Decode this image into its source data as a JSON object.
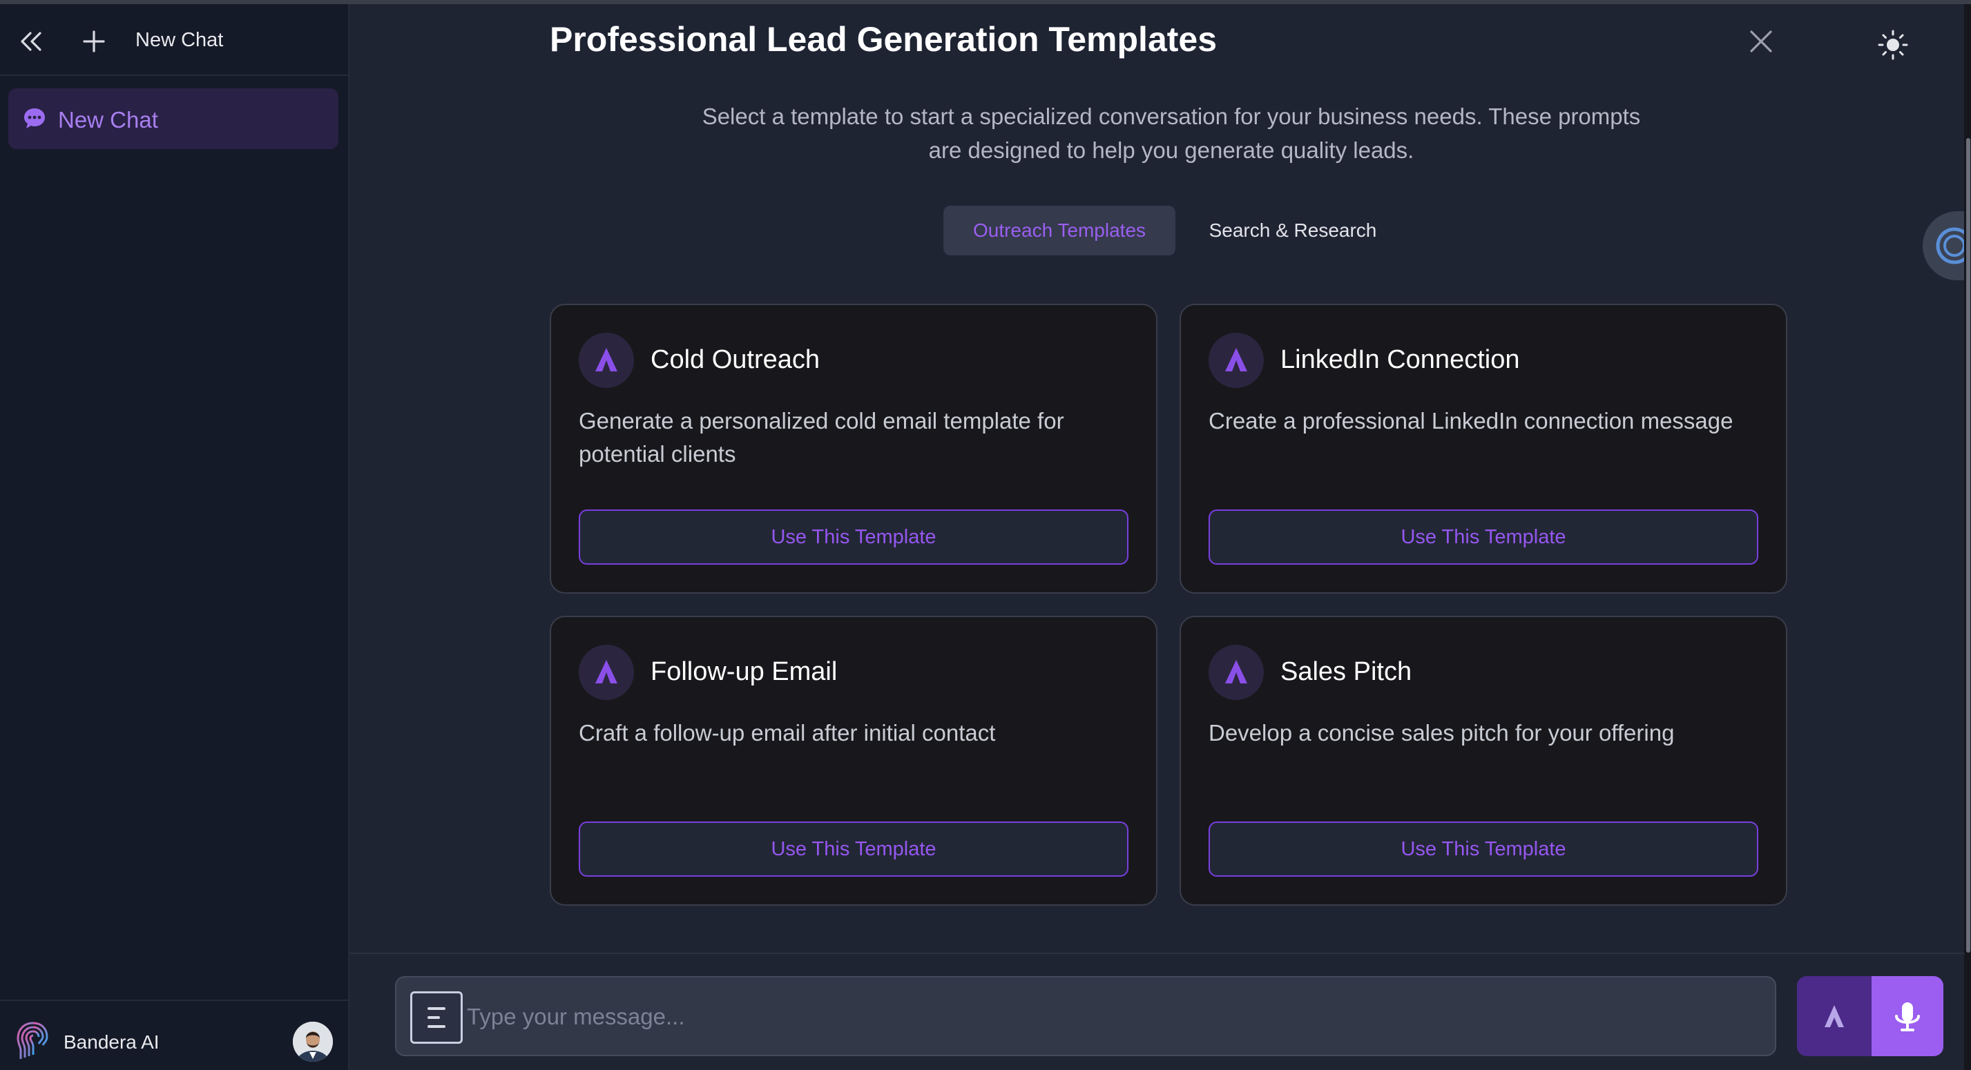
{
  "sidebar": {
    "header_title": "New Chat",
    "items": [
      {
        "label": "New Chat",
        "icon": "chat-bubble-icon",
        "active": true
      }
    ],
    "footer": {
      "brand_name": "Bandera AI",
      "brand_icon": "fingerprint-brain-icon",
      "avatar": "user-avatar"
    }
  },
  "main": {
    "title": "Professional Lead Generation Templates",
    "subtitle": "Select a template to start a specialized conversation for your business needs. These prompts are designed to help you generate quality leads.",
    "tabs": [
      {
        "label": "Outreach Templates",
        "active": true
      },
      {
        "label": "Search & Research",
        "active": false
      }
    ],
    "cards": [
      {
        "title": "Cold Outreach",
        "description": "Generate a personalized cold email template for potential clients",
        "button": "Use This Template"
      },
      {
        "title": "LinkedIn Connection",
        "description": "Create a professional LinkedIn connection message",
        "button": "Use This Template"
      },
      {
        "title": "Follow-up Email",
        "description": "Craft a follow-up email after initial contact",
        "button": "Use This Template"
      },
      {
        "title": "Sales Pitch",
        "description": "Develop a concise sales pitch for your offering",
        "button": "Use This Template"
      }
    ]
  },
  "composer": {
    "placeholder": "Type your message...",
    "value": ""
  },
  "colors": {
    "accent": "#9b5ef0",
    "sidebar_bg": "#151a28",
    "main_bg": "#1f2433",
    "card_bg": "#18181c"
  }
}
